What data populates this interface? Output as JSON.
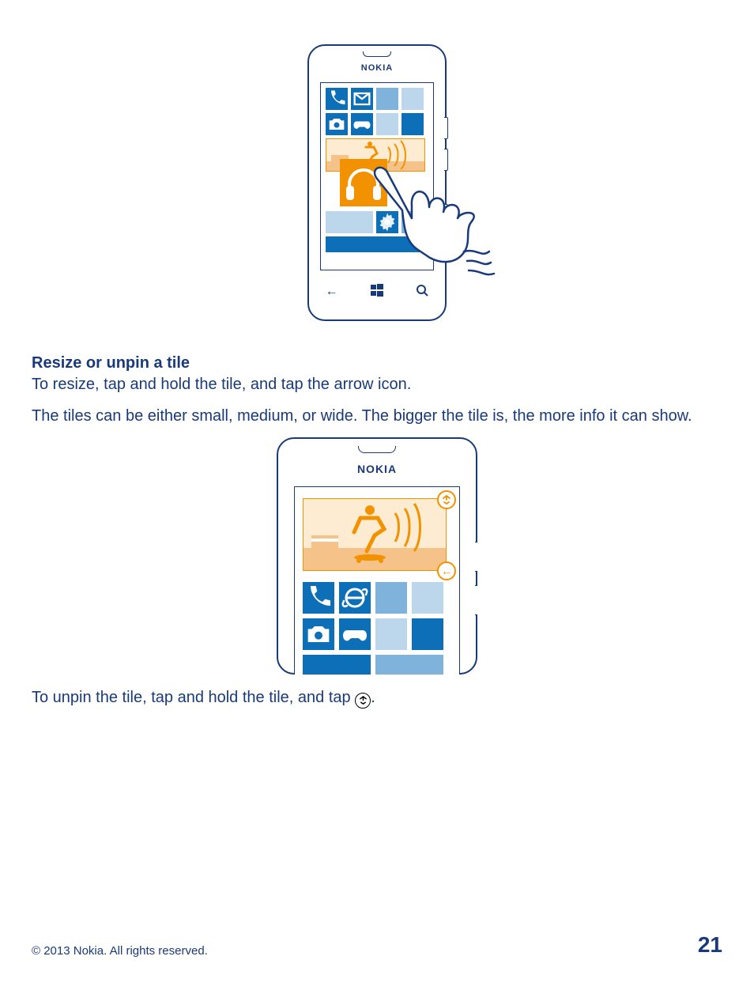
{
  "brand": "NOKIA",
  "section_title": "Resize or unpin a tile",
  "para1": "To resize, tap and hold the tile, and tap the arrow icon.",
  "para2": "The tiles can be either small, medium, or wide. The bigger the tile is, the more info it can show.",
  "para3_a": "To unpin the tile, tap and hold the tile, and tap ",
  "para3_b": ".",
  "footer": {
    "copyright": "© 2013 Nokia. All rights reserved.",
    "page": "21"
  }
}
